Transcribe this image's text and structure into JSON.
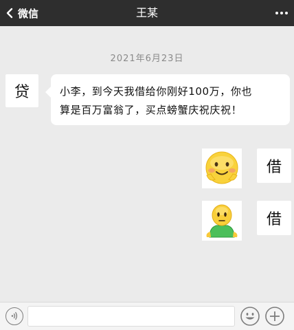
{
  "header": {
    "back_label": "微信",
    "title": "王某"
  },
  "timestamp": "2021年6月23日",
  "messages": [
    {
      "side": "left",
      "avatar_text": "贷",
      "line1": "小李，到今天我借给你刚好100万，你也",
      "line2": "算是百万富翁了，买点螃蟹庆祝庆祝！"
    },
    {
      "side": "right",
      "avatar_text": "借",
      "sticker": "blushing-smile-face"
    },
    {
      "side": "right",
      "avatar_text": "借",
      "sticker": "green-body-figure"
    }
  ],
  "icons": {
    "back": "chevron-left-icon",
    "more": "more-dots-icon",
    "voice": "voice-icon",
    "emoji": "emoji-icon",
    "plus": "plus-icon"
  },
  "colors": {
    "topbar": "#2e2e2e",
    "background": "#ebebeb",
    "bubble": "#ffffff"
  }
}
